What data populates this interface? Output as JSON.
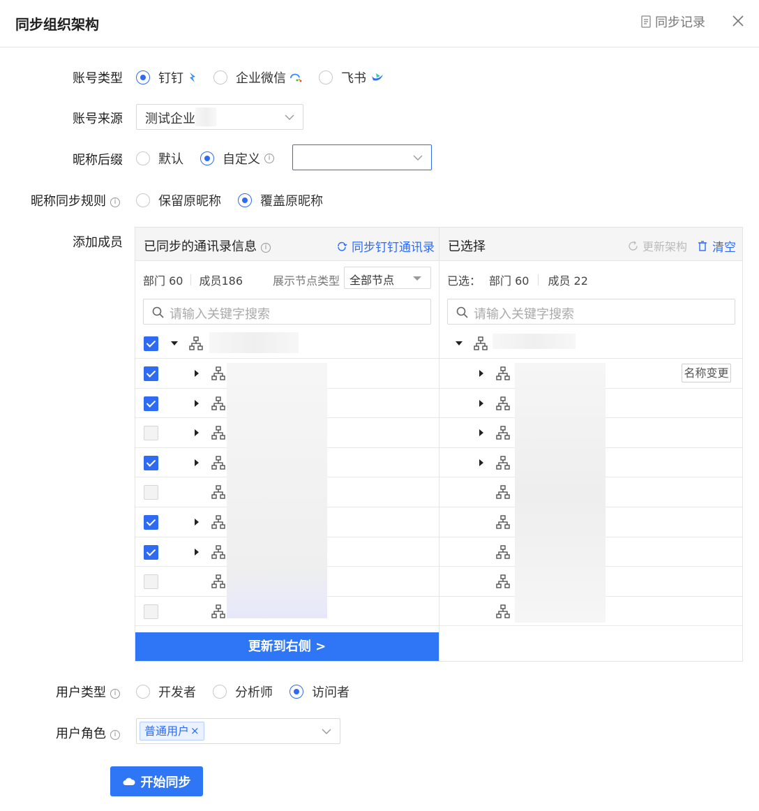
{
  "header": {
    "title": "同步组织架构",
    "history_label": "同步记录"
  },
  "form": {
    "account_type": {
      "label": "账号类型",
      "options": [
        {
          "label": "钉钉",
          "selected": true,
          "icon": "dingtalk-logo-icon"
        },
        {
          "label": "企业微信",
          "selected": false,
          "icon": "wecom-logo-icon"
        },
        {
          "label": "飞书",
          "selected": false,
          "icon": "feishu-logo-icon"
        }
      ]
    },
    "account_source": {
      "label": "账号来源",
      "value": "测试企业"
    },
    "nickname_suffix": {
      "label": "昵称后缀",
      "options": [
        {
          "label": "默认",
          "selected": false
        },
        {
          "label": "自定义",
          "selected": true
        }
      ],
      "custom_value": ""
    },
    "nickname_rule": {
      "label": "昵称同步规则",
      "options": [
        {
          "label": "保留原昵称",
          "selected": false
        },
        {
          "label": "覆盖原昵称",
          "selected": true
        }
      ]
    },
    "add_members": {
      "label": "添加成员"
    },
    "user_type": {
      "label": "用户类型",
      "options": [
        {
          "label": "开发者",
          "selected": false
        },
        {
          "label": "分析师",
          "selected": false
        },
        {
          "label": "访问者",
          "selected": true
        }
      ]
    },
    "user_role": {
      "label": "用户角色",
      "tags": [
        "普通用户"
      ]
    },
    "start_button": "开始同步"
  },
  "left_panel": {
    "title": "已同步的通讯录信息",
    "sync_link": "同步钉钉通讯录",
    "dept_label": "部门 60",
    "member_label": "成员186",
    "node_type_label": "展示节点类型",
    "node_type_value": "全部节点",
    "search_placeholder": "请输入关键字搜索",
    "rows": [
      {
        "checked": true,
        "expandable": true
      },
      {
        "checked": true,
        "expandable": true
      },
      {
        "checked": false,
        "expandable": true
      },
      {
        "checked": true,
        "expandable": true
      },
      {
        "checked": false,
        "expandable": false
      },
      {
        "checked": true,
        "expandable": true
      },
      {
        "checked": true,
        "expandable": true
      },
      {
        "checked": false,
        "expandable": false
      },
      {
        "checked": false,
        "expandable": false
      }
    ],
    "update_button": "更新到右侧 >"
  },
  "right_panel": {
    "title": "已选择",
    "refresh_label": "更新架构",
    "clear_label": "清空",
    "selected_prefix": "已选：",
    "dept_label": "部门 60",
    "member_label": "成员 22",
    "search_placeholder": "请输入关键字搜索",
    "rename_badge": "名称变更",
    "rows": [
      {
        "expandable": true
      },
      {
        "expandable": true
      },
      {
        "expandable": true
      },
      {
        "expandable": true
      },
      {
        "expandable": false
      },
      {
        "expandable": false
      },
      {
        "expandable": false
      },
      {
        "expandable": false
      },
      {
        "expandable": false
      }
    ]
  }
}
